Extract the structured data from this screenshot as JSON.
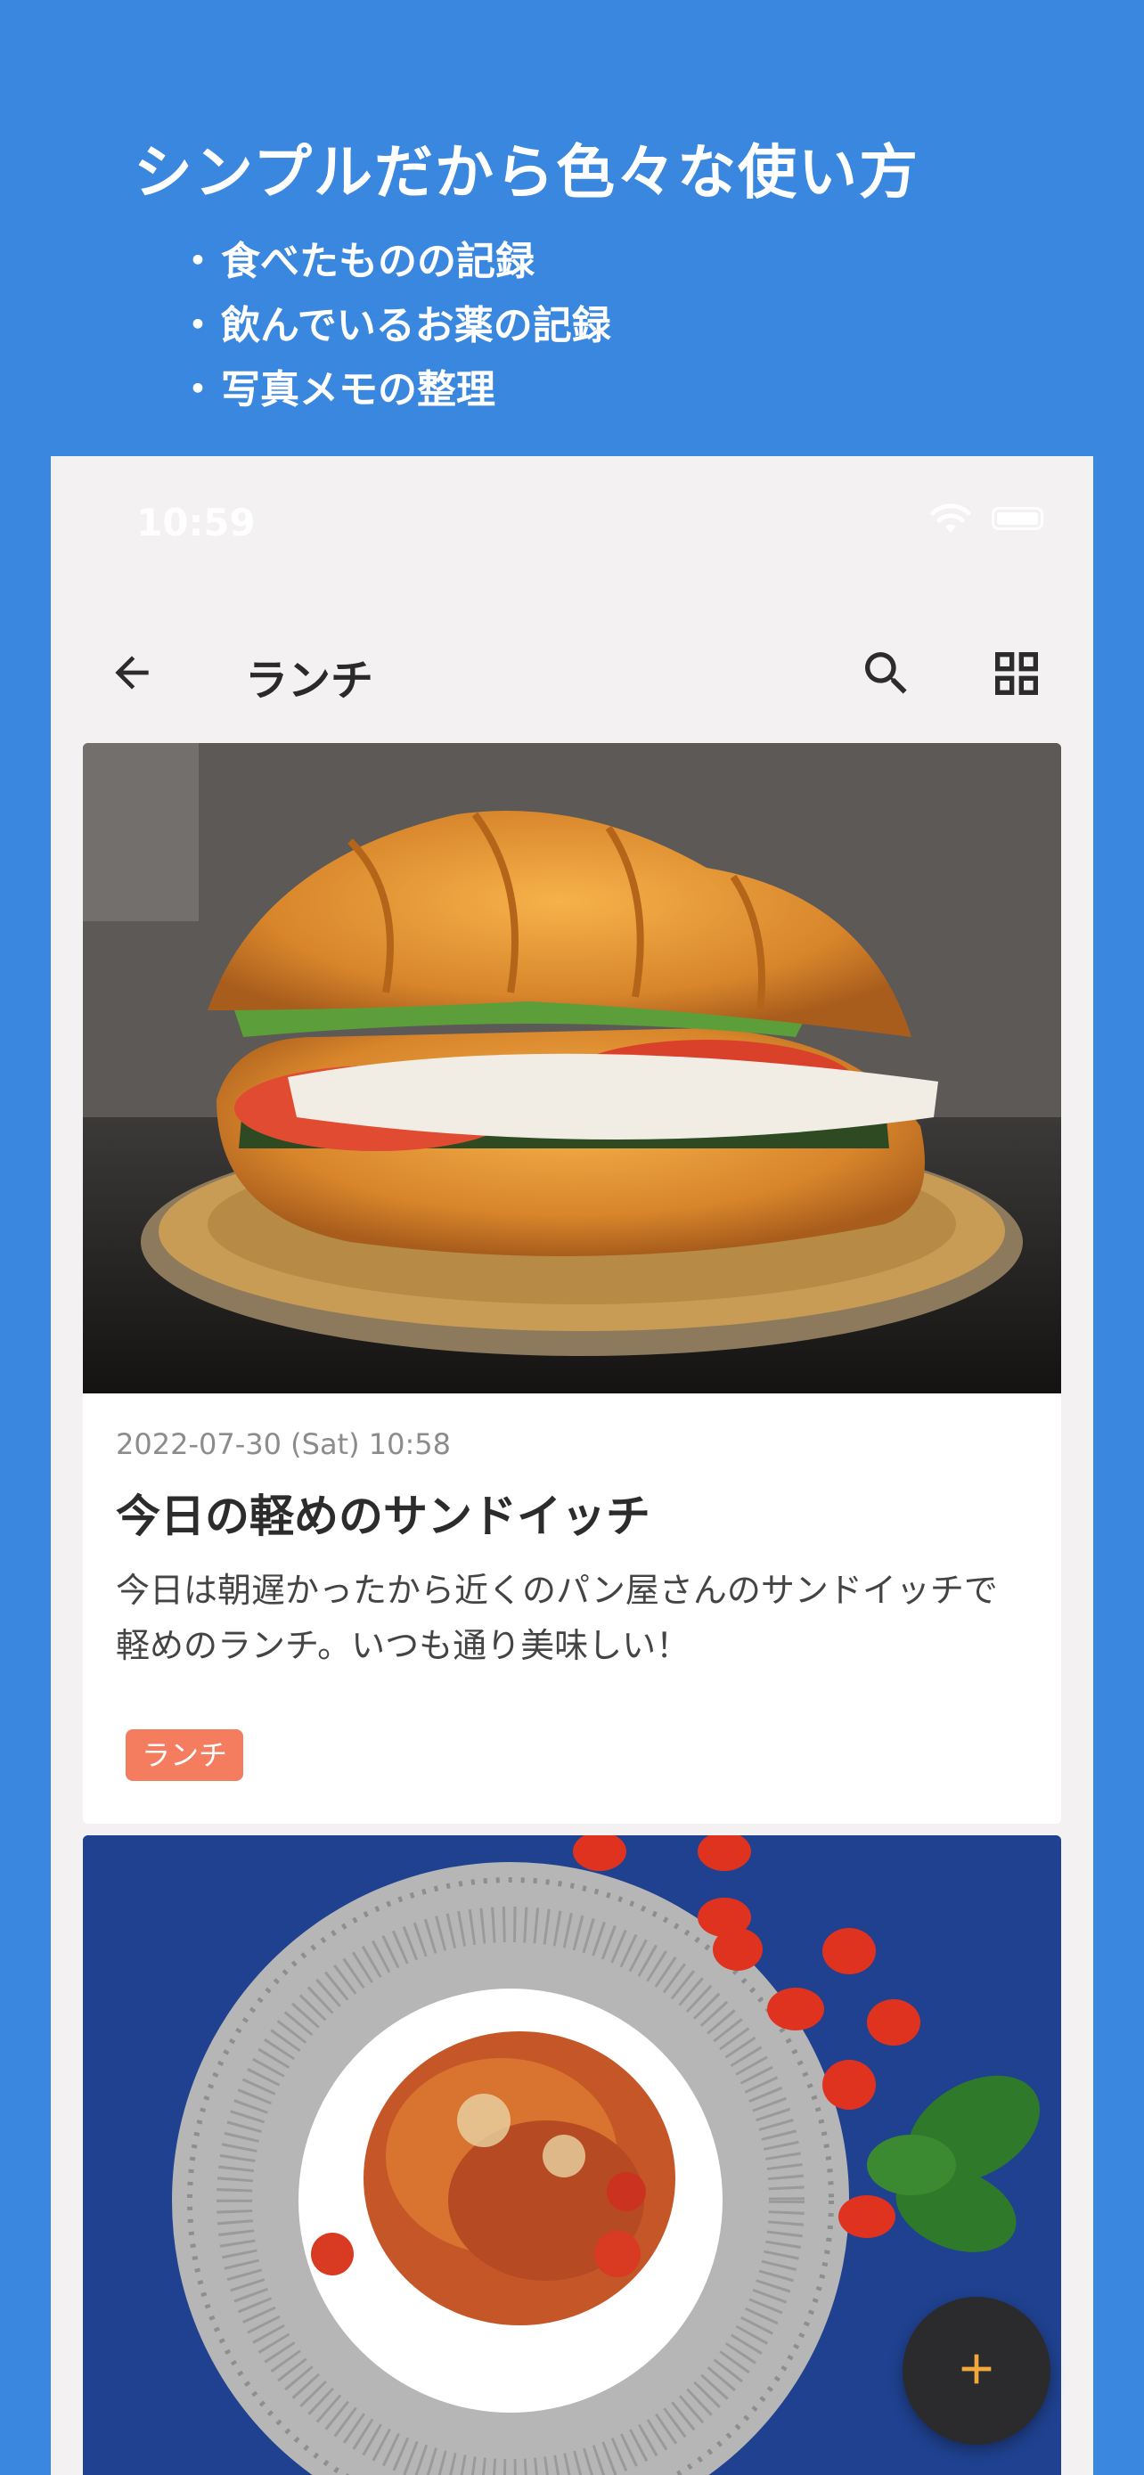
{
  "promo": {
    "title": "シンプルだから色々な使い方",
    "bullets": [
      "食べたものの記録",
      "飲んでいるお薬の記録",
      "写真メモの整理"
    ]
  },
  "status_bar": {
    "time": "10:59"
  },
  "app_bar": {
    "title": "ランチ"
  },
  "posts": [
    {
      "date": "2022-07-30 (Sat) 10:58",
      "title": "今日の軽めのサンドイッチ",
      "body": "今日は朝遅かったから近くのパン屋さんのサンドイッチで軽めのランチ。いつも通り美味しい！",
      "tag": "ランチ"
    }
  ],
  "colors": {
    "background": "#3a87e0",
    "screen": "#f3f1f2",
    "tag": "#f47c5f",
    "fab": "#2b2b2e",
    "fab_plus": "#f2a93b"
  },
  "icons": {
    "back": "arrow-left-icon",
    "search": "search-icon",
    "view_toggle": "grid-view-icon",
    "add": "plus-icon"
  }
}
